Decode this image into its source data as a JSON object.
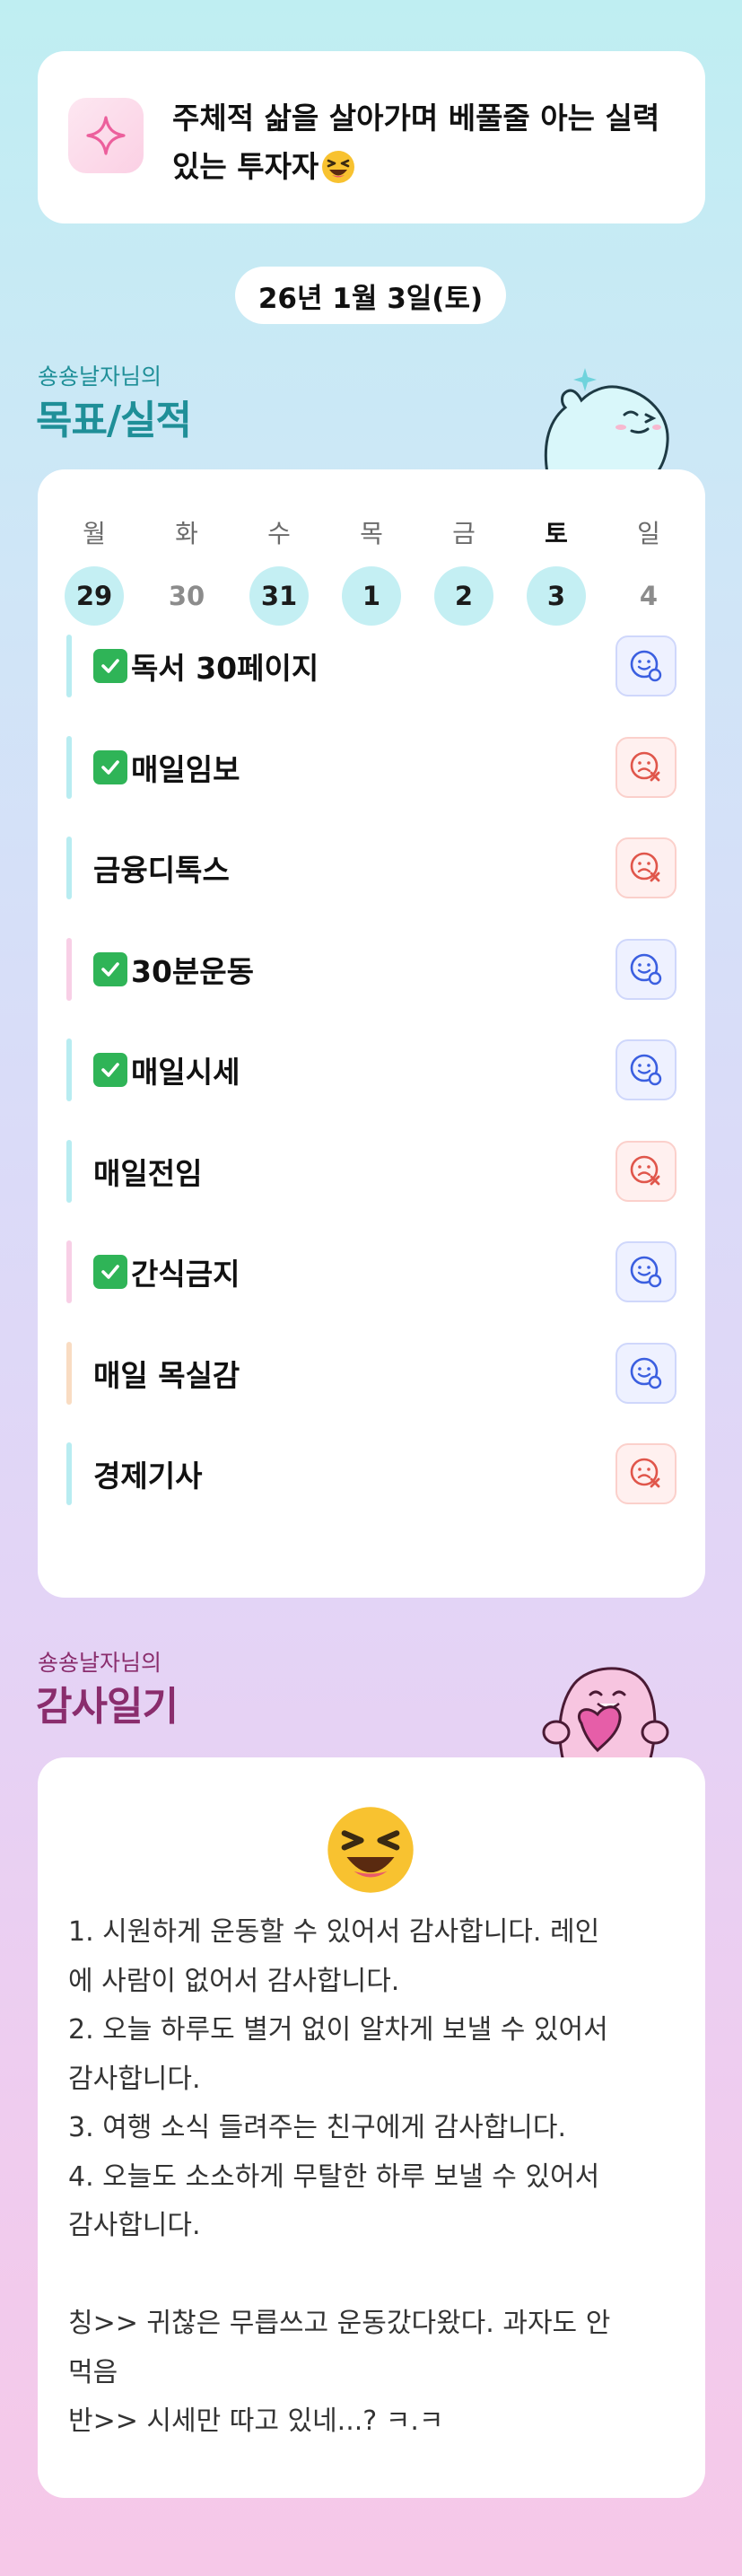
{
  "motto": {
    "line1": "주체적 삶을 살아가며 베풀줄 아는 실력",
    "line2": "있는 투자자"
  },
  "date": "26년 1월 3일(토)",
  "goals_section": {
    "owner": "숑숑날자님의",
    "title": "목표/실적"
  },
  "calendar": {
    "days": [
      {
        "dow": "월",
        "num": "29",
        "filled": true,
        "muted": false,
        "today": false
      },
      {
        "dow": "화",
        "num": "30",
        "filled": false,
        "muted": true,
        "today": false
      },
      {
        "dow": "수",
        "num": "31",
        "filled": true,
        "muted": false,
        "today": false
      },
      {
        "dow": "목",
        "num": "1",
        "filled": true,
        "muted": false,
        "today": false
      },
      {
        "dow": "금",
        "num": "2",
        "filled": true,
        "muted": false,
        "today": false
      },
      {
        "dow": "토",
        "num": "3",
        "filled": true,
        "muted": false,
        "today": true
      },
      {
        "dow": "일",
        "num": "4",
        "filled": false,
        "muted": true,
        "today": false
      }
    ]
  },
  "goals": [
    {
      "label": "독서 30페이지",
      "checked": true,
      "status": "done",
      "bar_color": "#b8ecf1"
    },
    {
      "label": "매일임보",
      "checked": true,
      "status": "fail",
      "bar_color": "#b8ecf1"
    },
    {
      "label": "금융디톡스",
      "checked": false,
      "status": "fail",
      "bar_color": "#b8ecf1"
    },
    {
      "label": "30분운동",
      "checked": true,
      "status": "done",
      "bar_color": "#f8cfe6"
    },
    {
      "label": "매일시세",
      "checked": true,
      "status": "done",
      "bar_color": "#b8ecf1"
    },
    {
      "label": "매일전임",
      "checked": false,
      "status": "fail",
      "bar_color": "#b8ecf1"
    },
    {
      "label": "간식금지",
      "checked": true,
      "status": "done",
      "bar_color": "#f8cfe6"
    },
    {
      "label": "매일 목실감",
      "checked": false,
      "status": "done",
      "bar_color": "#f9dcc2"
    },
    {
      "label": "경제기사",
      "checked": false,
      "status": "fail",
      "bar_color": "#b8ecf1"
    }
  ],
  "gratitude_section": {
    "owner": "숑숑날자님의",
    "title": "감사일기"
  },
  "gratitude": {
    "lines": [
      "1. 시원하게 운동할 수 있어서 감사합니다. 레인",
      "에 사람이 없어서 감사합니다.",
      "2. 오늘 하루도 별거 없이 알차게 보낼 수 있어서",
      "감사합니다.",
      "3. 여행 소식 들려주는 친구에게 감사합니다.",
      "4. 오늘도 소소하게 무탈한 하루 보낼 수 있어서",
      "감사합니다.",
      "",
      "칭>> 귀찮은 무릅쓰고 운동갔다왔다. 과자도 안",
      "먹음",
      "반>> 시세만 따고 있네...? ㅋ.ㅋ"
    ]
  },
  "colors": {
    "teal_title": "#1f8f98",
    "purple_title": "#8a2d6d",
    "done_icon": "#3b5fe0",
    "fail_icon": "#e0564b"
  }
}
